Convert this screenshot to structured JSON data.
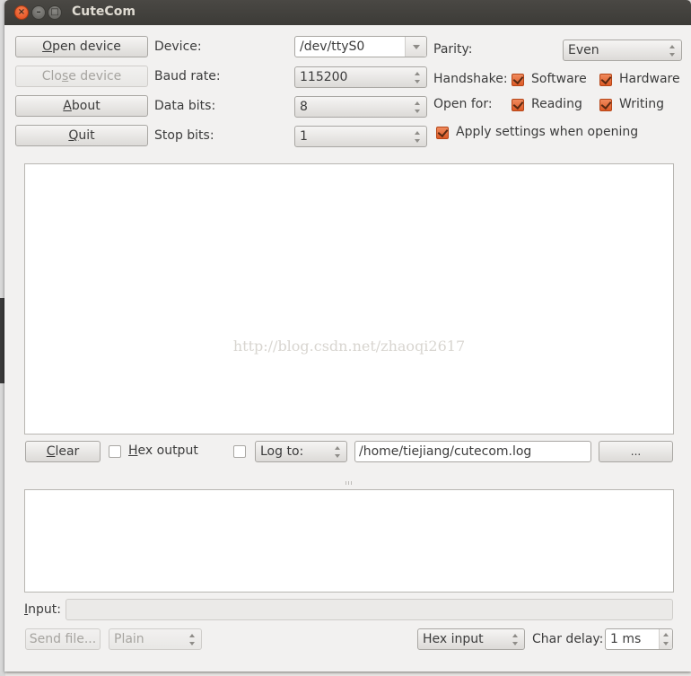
{
  "window": {
    "title": "CuteCom",
    "controls": {
      "close": "×",
      "minimize": "–",
      "maximize": "□"
    }
  },
  "buttons": {
    "open_device": {
      "prefix": "",
      "mnemonic": "O",
      "rest": "pen device",
      "enabled": true
    },
    "close_device": {
      "prefix": "Clo",
      "mnemonic": "s",
      "rest": "e device",
      "enabled": false
    },
    "about": {
      "prefix": "",
      "mnemonic": "A",
      "rest": "bout",
      "enabled": true
    },
    "quit": {
      "prefix": "",
      "mnemonic": "Q",
      "rest": "uit",
      "enabled": true
    }
  },
  "settings": {
    "device": {
      "label": "Device:",
      "value": "/dev/ttyS0"
    },
    "baud_rate": {
      "label": "Baud rate:",
      "value": "115200"
    },
    "data_bits": {
      "label": "Data bits:",
      "value": "8"
    },
    "stop_bits": {
      "label": "Stop bits:",
      "value": "1"
    },
    "parity": {
      "label": "Parity:",
      "value": "Even"
    },
    "handshake": {
      "label": "Handshake:",
      "software": {
        "label": "Software",
        "checked": true
      },
      "hardware": {
        "label": "Hardware",
        "checked": true
      }
    },
    "open_for": {
      "label": "Open for:",
      "reading": {
        "label": "Reading",
        "checked": true
      },
      "writing": {
        "label": "Writing",
        "checked": true
      }
    },
    "apply_settings": {
      "label": "Apply settings when opening",
      "checked": true
    }
  },
  "output": {
    "watermark": "http://blog.csdn.net/zhaoqi2617",
    "clear": {
      "mnemonic": "C",
      "rest": "lear"
    },
    "hex_output": {
      "mnemonic": "H",
      "rest": "ex output",
      "checked": false
    },
    "log_enabled": false,
    "log_mode": "Log to:",
    "log_path": "/home/tiejiang/cutecom.log",
    "browse": "..."
  },
  "input": {
    "label_mnemonic": "I",
    "label_rest": "nput:",
    "value": "",
    "send_file": "Send file...",
    "send_mode": "Plain",
    "input_mode": "Hex input",
    "char_delay_label": "Char delay:",
    "char_delay_value": "1 ms"
  },
  "colors": {
    "accent": "#dd5a26",
    "titlebar": "#3c3b37",
    "window_bg": "#f2f1f0"
  }
}
